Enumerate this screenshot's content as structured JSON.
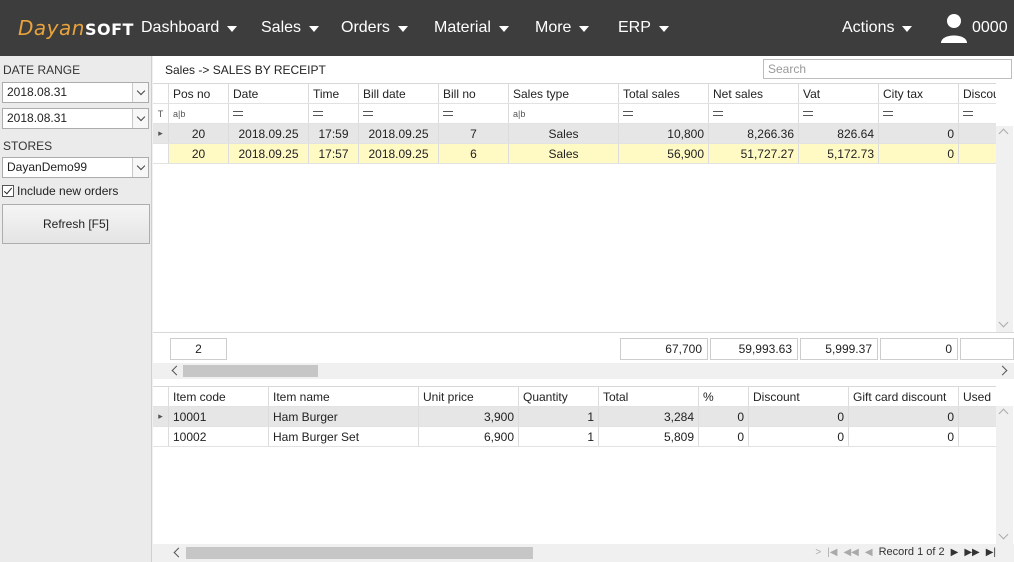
{
  "app": {
    "logo_part1": "Dayan",
    "logo_part2": "SOFT",
    "user_name": "0000"
  },
  "nav": [
    {
      "label": "Dashboard"
    },
    {
      "label": "Sales"
    },
    {
      "label": "Orders"
    },
    {
      "label": "Material"
    },
    {
      "label": "More"
    },
    {
      "label": "ERP"
    }
  ],
  "actions_label": "Actions",
  "left": {
    "date_range_label": "DATE RANGE",
    "date_from": "2018.08.31",
    "date_to": "2018.08.31",
    "stores_label": "STORES",
    "store": "DayanDemo99",
    "include_new_orders": "Include new orders",
    "refresh_label": "Refresh [F5]"
  },
  "main": {
    "breadcrumb": "Sales -> SALES BY RECEIPT",
    "search_placeholder": "Search",
    "receipts": {
      "columns": [
        "Pos no",
        "Date",
        "Time",
        "Bill date",
        "Bill no",
        "Sales type",
        "Total sales",
        "Net sales",
        "Vat",
        "City tax",
        "Discou"
      ],
      "rows": [
        [
          "20",
          "2018.09.25",
          "17:59",
          "2018.09.25",
          "7",
          "Sales",
          "10,800",
          "8,266.36",
          "826.64",
          "0"
        ],
        [
          "20",
          "2018.09.25",
          "17:57",
          "2018.09.25",
          "6",
          "Sales",
          "56,900",
          "51,727.27",
          "5,172.73",
          "0"
        ]
      ],
      "totals": {
        "count": "2",
        "total_sales": "67,700",
        "net_sales": "59,993.63",
        "vat": "5,999.37",
        "city_tax": "0"
      }
    },
    "items": {
      "columns": [
        "Item code",
        "Item name",
        "Unit price",
        "Quantity",
        "Total",
        "%",
        "Discount",
        "Gift card discount",
        "Used"
      ],
      "rows": [
        [
          "10001",
          "Ham Burger",
          "3,900",
          "1",
          "3,284",
          "0",
          "0",
          "0"
        ],
        [
          "10002",
          "Ham Burger Set",
          "6,900",
          "1",
          "5,809",
          "0",
          "0",
          "0"
        ]
      ],
      "record_text": "Record 1 of 2"
    }
  },
  "colors": {
    "topbar": "#3d3d3d",
    "logo_accent": "#e8a33b",
    "highlight_row": "#fff9c4"
  }
}
